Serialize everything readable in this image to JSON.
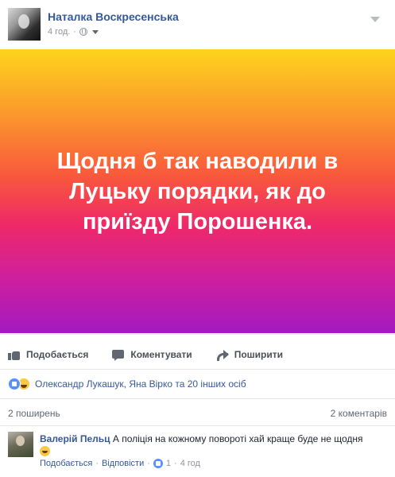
{
  "post": {
    "author": "Наталка Воскресенська",
    "time": "4 год.",
    "separator": "·",
    "banner_text": "Щодня б так наводили в Луцьку порядки, як до приїзду Порошенка."
  },
  "actions": {
    "like": "Подобається",
    "comment": "Коментувати",
    "share": "Поширити"
  },
  "reactions": {
    "text": "Олександр Лукашук, Яна Вірко та 20 інших осіб"
  },
  "counts": {
    "shares": "2 поширень",
    "comments": "2 коментарів"
  },
  "comment": {
    "author": "Валерій Пельц",
    "text": "А поліція на кожному повороті хай краще буде не щодня",
    "like": "Подобається",
    "reply": "Відповісти",
    "dot": "·",
    "like_count": "1",
    "time": "4 год"
  },
  "colors": {
    "link": "#365899",
    "meta": "#90949c",
    "banner_top": "#fdd41d",
    "banner_bottom": "#a21ac0"
  }
}
